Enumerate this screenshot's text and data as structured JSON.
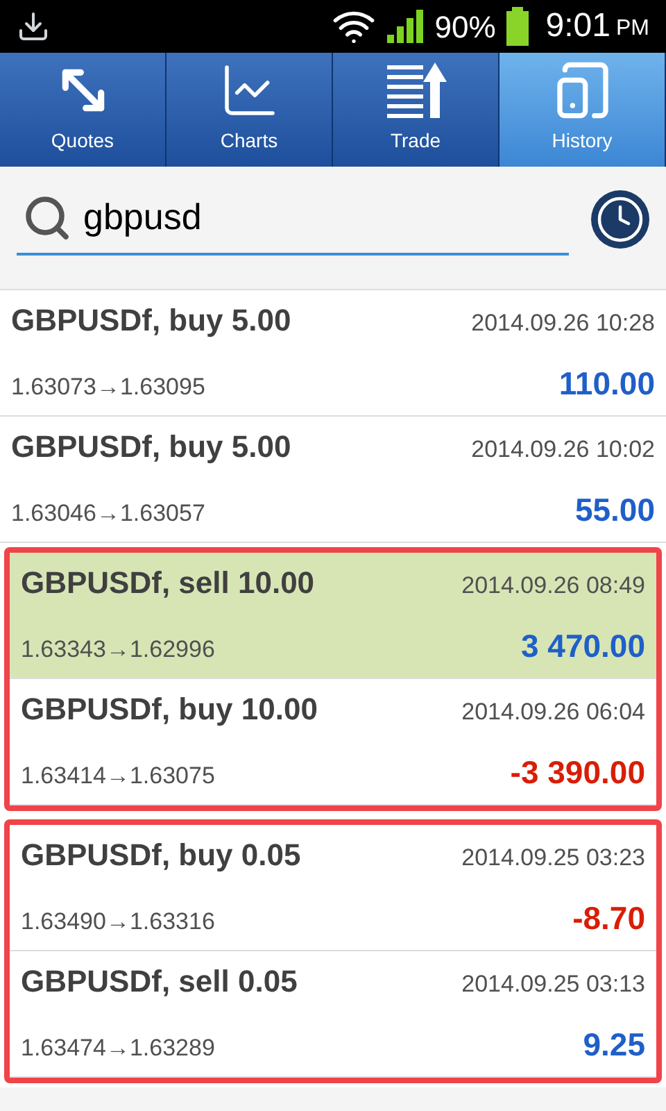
{
  "status_bar": {
    "battery": "90%",
    "time": "9:01",
    "ampm": "PM"
  },
  "tabs": [
    {
      "label": "Quotes",
      "kind": "quotes",
      "selected": false
    },
    {
      "label": "Charts",
      "kind": "charts",
      "selected": false
    },
    {
      "label": "Trade",
      "kind": "trade",
      "selected": false
    },
    {
      "label": "History",
      "kind": "history",
      "selected": true
    }
  ],
  "search": {
    "value": "gbpusd"
  },
  "groups": [
    {
      "outlined": false,
      "rows": [
        {
          "title": "GBPUSDf, buy 5.00",
          "time": "2014.09.26 10:28",
          "prices": "1.63073→1.63095",
          "profit": "110.00",
          "color": "#1f5fc8",
          "selected": false
        },
        {
          "title": "GBPUSDf, buy 5.00",
          "time": "2014.09.26 10:02",
          "prices": "1.63046→1.63057",
          "profit": "55.00",
          "color": "#1f5fc8",
          "selected": false
        }
      ]
    },
    {
      "outlined": true,
      "rows": [
        {
          "title": "GBPUSDf, sell 10.00",
          "time": "2014.09.26 08:49",
          "prices": "1.63343→1.62996",
          "profit": "3 470.00",
          "color": "#1f5fc8",
          "selected": true
        },
        {
          "title": "GBPUSDf, buy 10.00",
          "time": "2014.09.26 06:04",
          "prices": "1.63414→1.63075",
          "profit": "-3 390.00",
          "color": "#d81e06",
          "selected": false
        }
      ]
    },
    {
      "outlined": true,
      "rows": [
        {
          "title": "GBPUSDf, buy 0.05",
          "time": "2014.09.25 03:23",
          "prices": "1.63490→1.63316",
          "profit": "-8.70",
          "color": "#d81e06",
          "selected": false
        },
        {
          "title": "GBPUSDf, sell 0.05",
          "time": "2014.09.25 03:13",
          "prices": "1.63474→1.63289",
          "profit": "9.25",
          "color": "#1f5fc8",
          "selected": false
        }
      ]
    }
  ]
}
